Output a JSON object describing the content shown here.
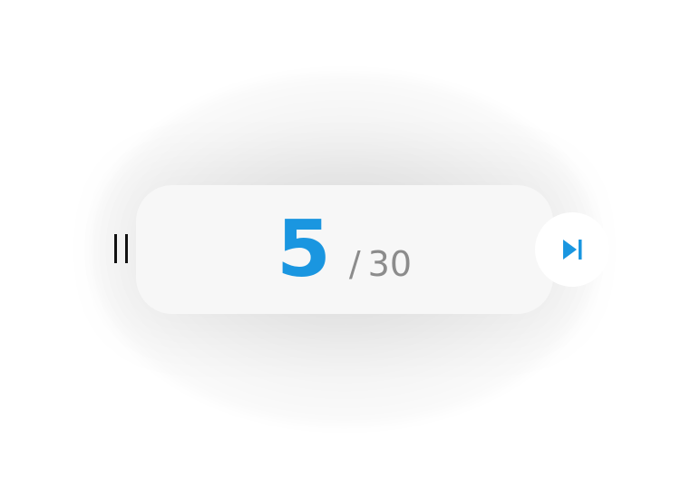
{
  "counter": {
    "current": "5",
    "separator": "/",
    "total": "30"
  },
  "controls": {
    "pause_icon": "pause-icon",
    "skip_icon": "skip-next-icon"
  },
  "colors": {
    "accent": "#1a96e0",
    "muted_text": "#8c8c8c",
    "icon_dark": "#111111",
    "card_background": "#f7f7f7"
  }
}
